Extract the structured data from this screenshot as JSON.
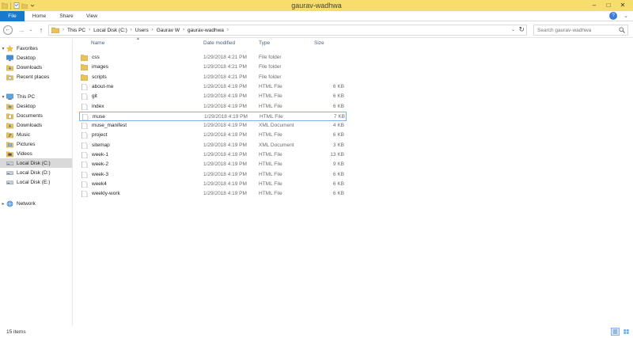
{
  "window": {
    "title": "gaurav-wadhwa",
    "minimize": "–",
    "maximize": "□",
    "close": "✕"
  },
  "ribbon": {
    "tabs": [
      "File",
      "Home",
      "Share",
      "View"
    ],
    "expand_glyph": "⌄",
    "help_glyph": "?"
  },
  "nav": {
    "back_glyph": "←",
    "forward_glyph": "→",
    "recent_glyph": "⌄",
    "up_glyph": "↑",
    "breadcrumb": [
      "This PC",
      "Local Disk (C:)",
      "Users",
      "Gaurav W",
      "gaurav-wadhwa"
    ],
    "crumb_sep": "›",
    "dropdown_glyph": "⌄",
    "refresh_glyph": "↻",
    "search_placeholder": "Search gaurav-wadhwa"
  },
  "navpane": {
    "groups": [
      {
        "label": "Favorites",
        "icon": "star-icon",
        "items": [
          {
            "label": "Desktop",
            "icon": "desktop-icon"
          },
          {
            "label": "Downloads",
            "icon": "downloads-icon"
          },
          {
            "label": "Recent places",
            "icon": "recent-places-icon"
          }
        ]
      },
      {
        "label": "This PC",
        "icon": "computer-icon",
        "items": [
          {
            "label": "Desktop",
            "icon": "desktop-icon"
          },
          {
            "label": "Documents",
            "icon": "documents-icon"
          },
          {
            "label": "Downloads",
            "icon": "downloads-icon"
          },
          {
            "label": "Music",
            "icon": "music-icon"
          },
          {
            "label": "Pictures",
            "icon": "pictures-icon"
          },
          {
            "label": "Videos",
            "icon": "videos-icon"
          },
          {
            "label": "Local Disk (C:)",
            "icon": "drive-icon",
            "selected": true
          },
          {
            "label": "Local Disk (D:)",
            "icon": "drive-icon"
          },
          {
            "label": "Local Disk (E:)",
            "icon": "drive-icon"
          }
        ]
      },
      {
        "label": "Network",
        "icon": "network-icon",
        "items": []
      }
    ]
  },
  "columns": {
    "name": "Name",
    "date": "Date modified",
    "type": "Type",
    "size": "Size",
    "sort_glyph": "▲"
  },
  "files": [
    {
      "name": "css",
      "date": "1/29/2018 4:21 PM",
      "type": "File folder",
      "size": "",
      "icon": "folder-icon"
    },
    {
      "name": "images",
      "date": "1/29/2018 4:21 PM",
      "type": "File folder",
      "size": "",
      "icon": "folder-icon"
    },
    {
      "name": "scripts",
      "date": "1/29/2018 4:21 PM",
      "type": "File folder",
      "size": "",
      "icon": "folder-icon"
    },
    {
      "name": "about-me",
      "date": "1/29/2018 4:19 PM",
      "type": "HTML File",
      "size": "6 KB",
      "icon": "file-icon"
    },
    {
      "name": "git",
      "date": "1/29/2018 4:19 PM",
      "type": "HTML File",
      "size": "6 KB",
      "icon": "file-icon"
    },
    {
      "name": "index",
      "date": "1/29/2018 4:19 PM",
      "type": "HTML File",
      "size": "6 KB",
      "icon": "file-icon"
    },
    {
      "name": "muse",
      "date": "1/29/2018 4:19 PM",
      "type": "HTML File",
      "size": "7 KB",
      "icon": "file-icon",
      "selected": true
    },
    {
      "name": "muse_manifest",
      "date": "1/29/2018 4:19 PM",
      "type": "XML Document",
      "size": "4 KB",
      "icon": "file-icon"
    },
    {
      "name": "project",
      "date": "1/29/2018 4:19 PM",
      "type": "HTML File",
      "size": "6 KB",
      "icon": "file-icon"
    },
    {
      "name": "sitemap",
      "date": "1/29/2018 4:19 PM",
      "type": "XML Document",
      "size": "3 KB",
      "icon": "file-icon"
    },
    {
      "name": "week-1",
      "date": "1/29/2018 4:19 PM",
      "type": "HTML File",
      "size": "13 KB",
      "icon": "file-icon"
    },
    {
      "name": "week-2",
      "date": "1/29/2018 4:19 PM",
      "type": "HTML File",
      "size": "9 KB",
      "icon": "file-icon"
    },
    {
      "name": "week-3",
      "date": "1/29/2018 4:19 PM",
      "type": "HTML File",
      "size": "6 KB",
      "icon": "file-icon"
    },
    {
      "name": "week4",
      "date": "1/29/2018 4:19 PM",
      "type": "HTML File",
      "size": "6 KB",
      "icon": "file-icon"
    },
    {
      "name": "weekly-work",
      "date": "1/29/2018 4:19 PM",
      "type": "HTML File",
      "size": "6 KB",
      "icon": "file-icon"
    }
  ],
  "status": {
    "item_count": "15 items"
  },
  "colors": {
    "titlebar": "#f6dd6c",
    "file_tab": "#1979ca",
    "folder": "#e8c25a",
    "selection_border": "#7eb4ea"
  }
}
